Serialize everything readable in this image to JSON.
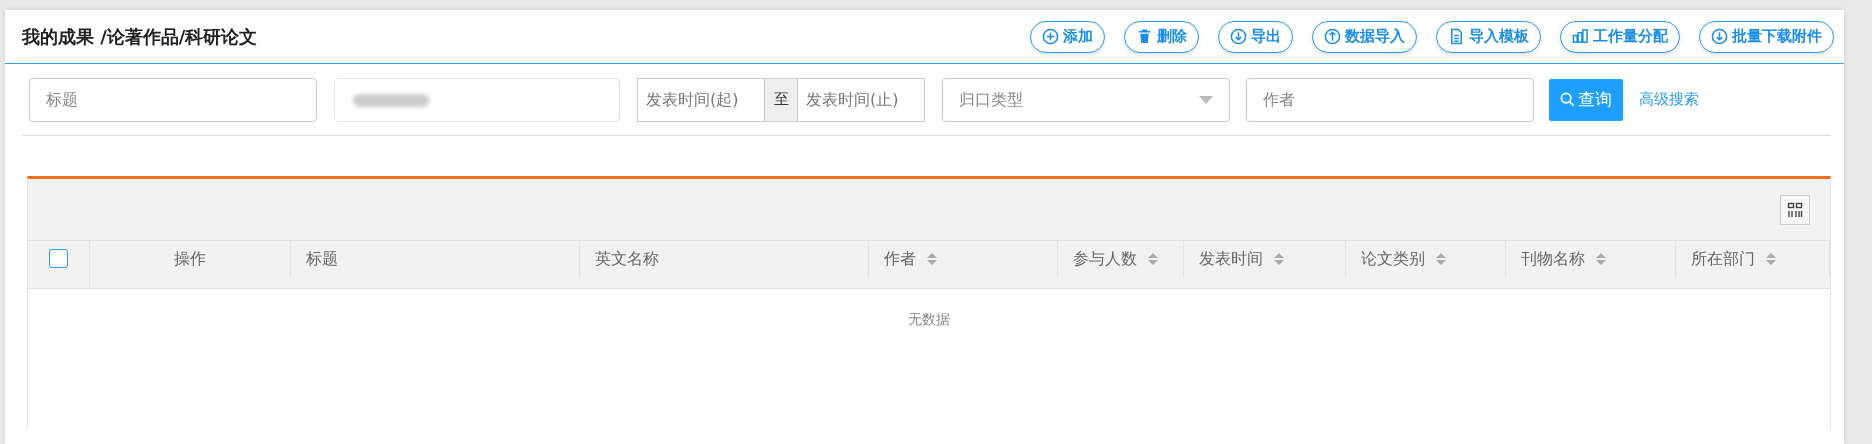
{
  "header": {
    "title": "我的成果 /论著作品/科研论文",
    "buttons": [
      {
        "label": "添加"
      },
      {
        "label": "删除"
      },
      {
        "label": "导出"
      },
      {
        "label": "数据导入"
      },
      {
        "label": "导入模板"
      },
      {
        "label": "工作量分配"
      },
      {
        "label": "批量下载附件"
      }
    ]
  },
  "filters": {
    "title": {
      "placeholder": "标题"
    },
    "date_start": {
      "placeholder": "发表时间(起)"
    },
    "date_separator": "至",
    "date_end": {
      "placeholder": "发表时间(止)"
    },
    "category": {
      "placeholder": "归口类型"
    },
    "author": {
      "placeholder": "作者"
    },
    "search_button": "查询",
    "advanced_link": "高级搜索"
  },
  "table": {
    "select_all": {
      "checked": false
    },
    "columns": [
      {
        "label": "操作",
        "sortable": false
      },
      {
        "label": "标题",
        "sortable": false
      },
      {
        "label": "英文名称",
        "sortable": false
      },
      {
        "label": "作者",
        "sortable": true
      },
      {
        "label": "参与人数",
        "sortable": true
      },
      {
        "label": "发表时间",
        "sortable": true
      },
      {
        "label": "论文类别",
        "sortable": true
      },
      {
        "label": "刊物名称",
        "sortable": true
      },
      {
        "label": "所在部门",
        "sortable": true
      }
    ],
    "empty_text": "无数据"
  }
}
